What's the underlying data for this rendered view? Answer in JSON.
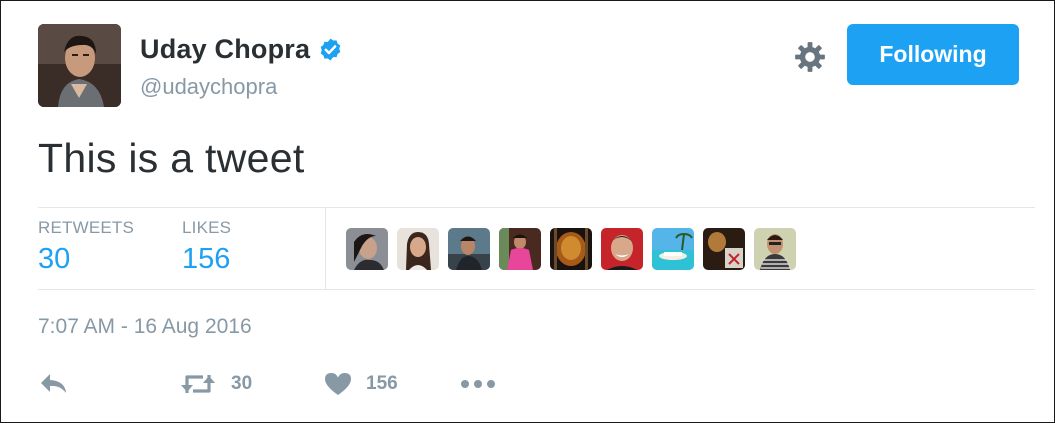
{
  "tweet": {
    "author": {
      "display_name": "Uday Chopra",
      "handle": "@udaychopra",
      "verified": true
    },
    "follow_button_label": "Following",
    "text": "This is a tweet",
    "stats": {
      "retweets_label": "RETWEETS",
      "retweets_count": "30",
      "likes_label": "LIKES",
      "likes_count": "156"
    },
    "liker_avatars": [
      {
        "icon": "avatar-woman-dark-hair"
      },
      {
        "icon": "avatar-woman-long-hair"
      },
      {
        "icon": "avatar-man-outdoor"
      },
      {
        "icon": "avatar-person-pink-shirt"
      },
      {
        "icon": "avatar-dark-orange-object"
      },
      {
        "icon": "avatar-man-smiling"
      },
      {
        "icon": "avatar-beach-scene"
      },
      {
        "icon": "avatar-dark-scene"
      },
      {
        "icon": "avatar-man-striped-shirt"
      }
    ],
    "timestamp": "7:07 AM - 16 Aug 2016",
    "actions": {
      "reply_icon": "reply-icon",
      "retweet_count": "30",
      "like_count": "156",
      "more_icon": "more-icon"
    }
  },
  "colors": {
    "accent": "#1da1f2",
    "text": "#292f33",
    "muted": "#8899a6",
    "divider": "#e1e8ed"
  }
}
